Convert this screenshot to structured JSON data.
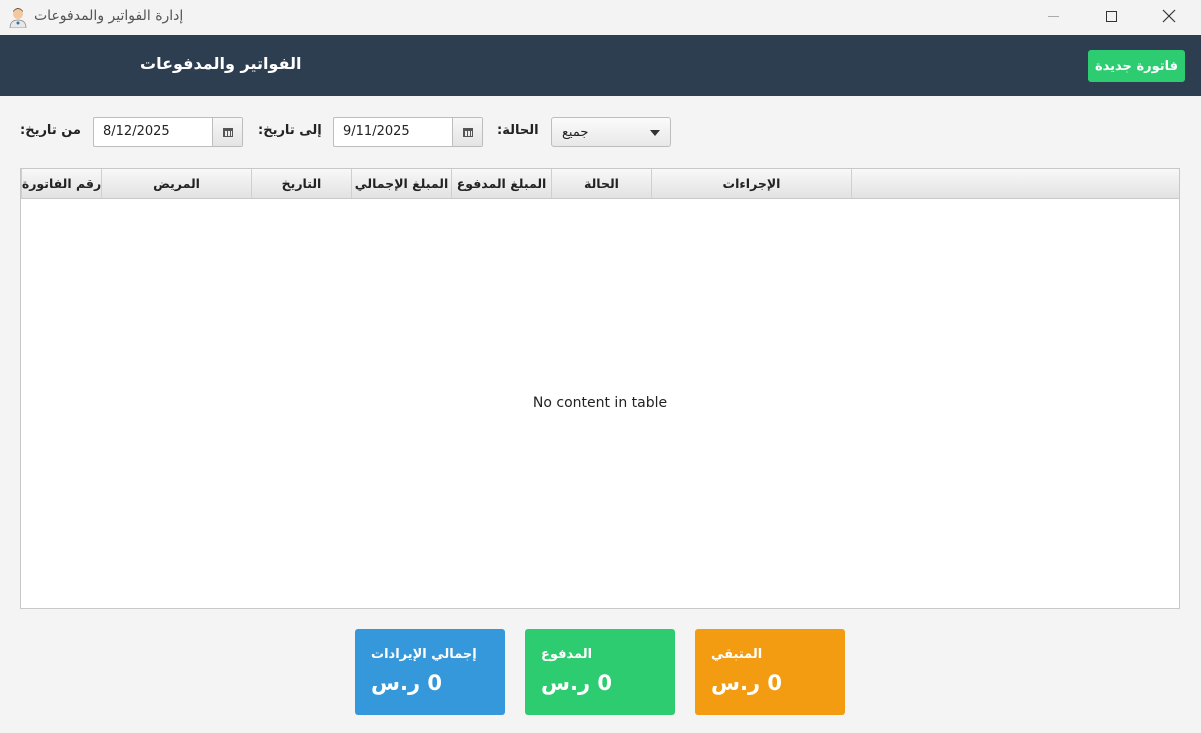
{
  "window": {
    "title": "إدارة الفواتير والمدفوعات"
  },
  "header": {
    "title": "الفواتير والمدفوعات",
    "new_invoice_label": "فاتورة جديدة"
  },
  "filters": {
    "from_label": "من تاريخ:",
    "from_value": "8/12/2025",
    "to_label": "إلى تاريخ:",
    "to_value": "9/11/2025",
    "status_label": "الحالة:",
    "status_value": "جميع"
  },
  "table": {
    "columns": [
      "رقم الفاتورة",
      "المريض",
      "التاريخ",
      "المبلغ الإجمالي",
      "المبلغ المدفوع",
      "الحالة",
      "الإجراءات"
    ],
    "empty_message": "No content in table"
  },
  "summary": {
    "total": {
      "label": "إجمالي الإيرادات",
      "value": "0 ر.س"
    },
    "paid": {
      "label": "المدفوع",
      "value": "0 ر.س"
    },
    "remaining": {
      "label": "المتبقي",
      "value": "0 ر.س"
    }
  },
  "colors": {
    "header_bg": "#2c3e50",
    "new_button": "#2ecc71",
    "card_total": "#3498db",
    "card_paid": "#2ecc71",
    "card_remaining": "#f39c12"
  }
}
